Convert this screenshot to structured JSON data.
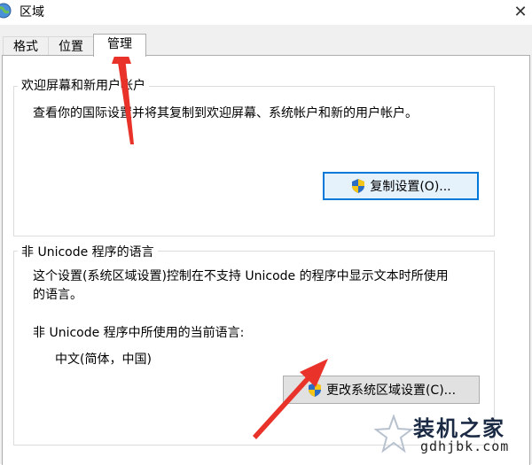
{
  "window": {
    "title": "区域"
  },
  "tabs": [
    {
      "label": "格式"
    },
    {
      "label": "位置"
    },
    {
      "label": "管理"
    }
  ],
  "welcome_group": {
    "title": "欢迎屏幕和新用户帐户",
    "description": "查看你的国际设置并将其复制到欢迎屏幕、系统帐户和新的用户帐户。",
    "copy_button": "复制设置(O)..."
  },
  "unicode_group": {
    "title": "非 Unicode 程序的语言",
    "description_line1": "这个设置(系统区域设置)控制在不支持 Unicode 的程序中显示文本时所使用",
    "description_line2": "的语言。",
    "current_label": "非 Unicode 程序中所使用的当前语言:",
    "current_value": "中文(简体，中国)",
    "change_button": "更改系统区域设置(C)..."
  },
  "watermark": {
    "title": "装机之家",
    "url": "gdhjbk.com"
  },
  "colors": {
    "accent": "#0078d7",
    "annotation_arrow": "#e8322a"
  }
}
